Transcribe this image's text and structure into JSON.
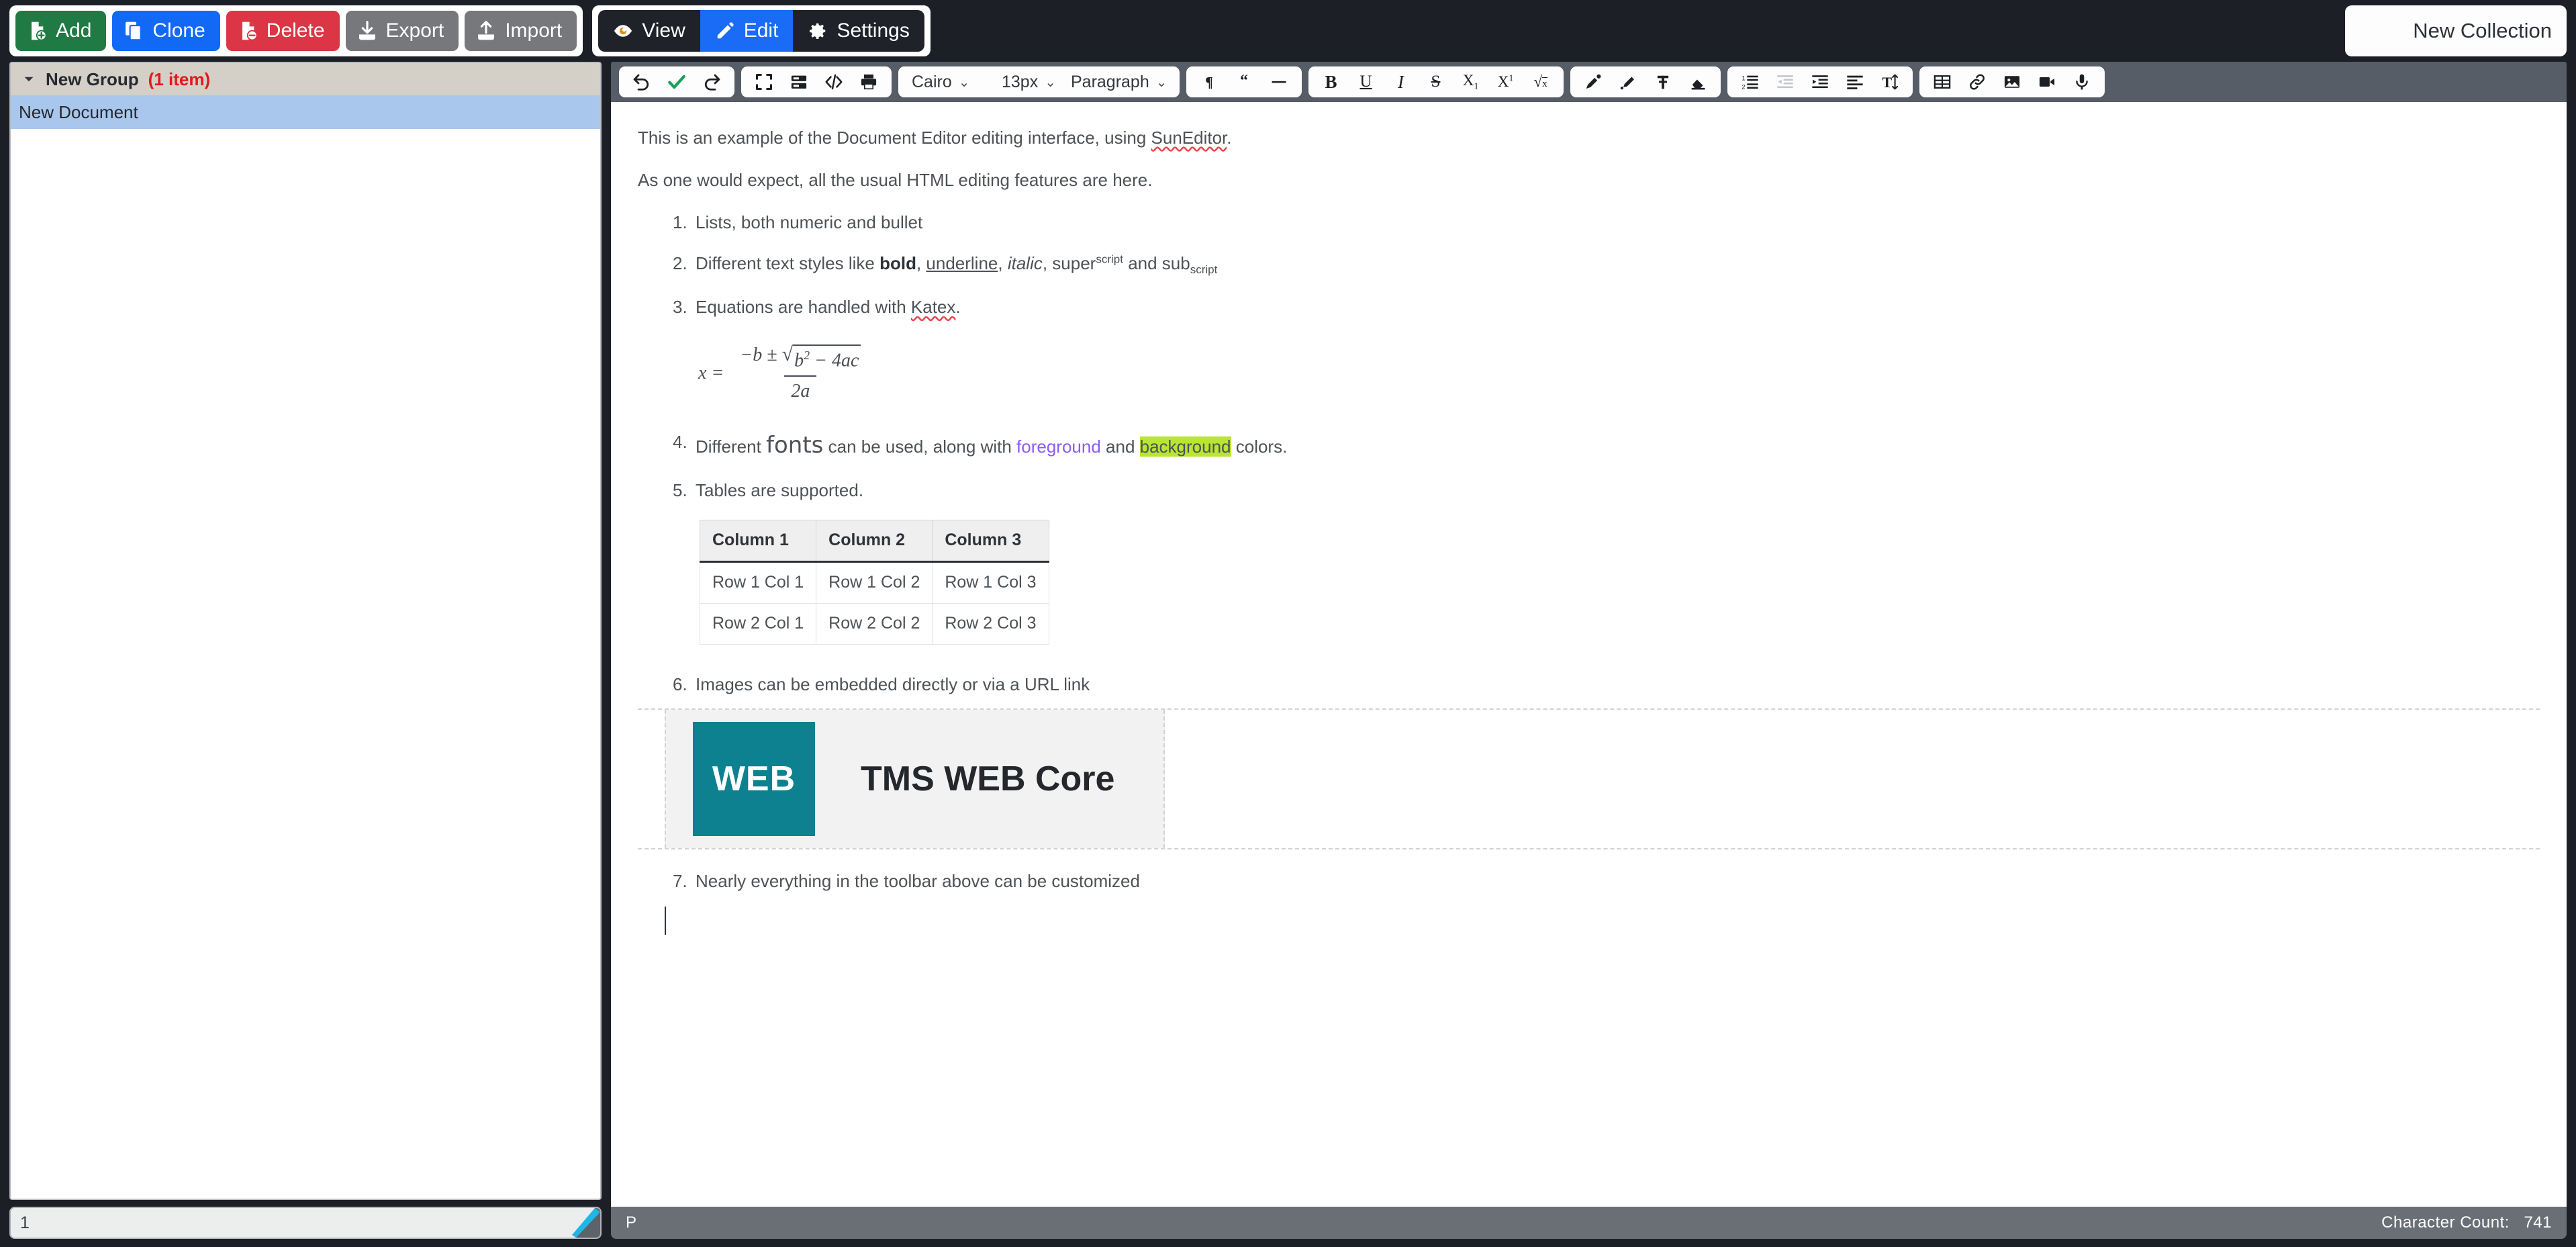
{
  "toolbar": {
    "buttons": [
      {
        "label": "Add",
        "icon": "file-add-icon",
        "color": "#1f7a43"
      },
      {
        "label": "Clone",
        "icon": "copy-icon",
        "color": "#1169f5"
      },
      {
        "label": "Delete",
        "icon": "file-remove-icon",
        "color": "#dc3545"
      },
      {
        "label": "Export",
        "icon": "download-icon",
        "color": "#76787c"
      },
      {
        "label": "Import",
        "icon": "upload-icon",
        "color": "#76787c"
      }
    ],
    "modes": [
      {
        "label": "View",
        "icon": "eye-icon",
        "active": false
      },
      {
        "label": "Edit",
        "icon": "pencil-icon",
        "active": true
      },
      {
        "label": "Settings",
        "icon": "gear-icon",
        "active": false
      }
    ],
    "collection_title": "New Collection",
    "accent_active": "#1a6bf5"
  },
  "sidebar": {
    "group": {
      "label": "New Group",
      "count": "(1 item)",
      "expanded": true
    },
    "documents": [
      {
        "label": "New Document",
        "selected": true
      }
    ],
    "status": "1"
  },
  "editor_toolbar": {
    "history": [
      {
        "name": "undo-icon",
        "label": "Undo"
      },
      {
        "name": "check-icon",
        "label": "Save"
      },
      {
        "name": "redo-icon",
        "label": "Redo"
      }
    ],
    "view_tools": [
      {
        "name": "fullscreen-icon",
        "label": "Full Screen"
      },
      {
        "name": "preview-icon",
        "label": "Preview"
      },
      {
        "name": "code-view-icon",
        "label": "Code View"
      },
      {
        "name": "print-icon",
        "label": "Print"
      }
    ],
    "font_family": "Cairo",
    "font_size": "13px",
    "paragraph_style": "Paragraph",
    "block_tools": [
      {
        "name": "paragraph-icon",
        "label": "Paragraph Mark"
      },
      {
        "name": "blockquote-icon",
        "label": "Blockquote"
      },
      {
        "name": "horizontal-rule-icon",
        "label": "Horizontal Line"
      }
    ],
    "text_tools": [
      {
        "name": "bold-icon",
        "label": "B"
      },
      {
        "name": "underline-icon",
        "label": "U"
      },
      {
        "name": "italic-icon",
        "label": "I"
      },
      {
        "name": "strikethrough-icon",
        "label": "S"
      },
      {
        "name": "subscript-icon",
        "label": "X"
      },
      {
        "name": "superscript-icon",
        "label": "X"
      },
      {
        "name": "math-icon",
        "label": "Math"
      }
    ],
    "color_tools": [
      {
        "name": "font-color-icon",
        "label": "Font Color"
      },
      {
        "name": "highlight-color-icon",
        "label": "Highlight Color"
      },
      {
        "name": "text-style-icon",
        "label": "Text Style"
      },
      {
        "name": "remove-format-icon",
        "label": "Remove Format"
      }
    ],
    "list_tools": [
      {
        "name": "ordered-list-icon",
        "label": "List",
        "disabled": false
      },
      {
        "name": "outdent-icon",
        "label": "Outdent",
        "disabled": true
      },
      {
        "name": "indent-icon",
        "label": "Indent",
        "disabled": false
      },
      {
        "name": "align-icon",
        "label": "Align",
        "disabled": false
      },
      {
        "name": "line-height-icon",
        "label": "Line Height",
        "disabled": false
      }
    ],
    "insert_tools": [
      {
        "name": "table-icon",
        "label": "Table"
      },
      {
        "name": "link-icon",
        "label": "Link"
      },
      {
        "name": "image-icon",
        "label": "Image"
      },
      {
        "name": "video-icon",
        "label": "Video"
      },
      {
        "name": "audio-icon",
        "label": "Audio"
      }
    ]
  },
  "document": {
    "intro_1_a": "This is an example of the Document Editor editing interface, using ",
    "intro_1_link": "SunEditor",
    "intro_1_b": ".",
    "intro_2": "As one would expect, all the usual HTML editing features are here.",
    "items": [
      {
        "num": "1.",
        "text": "Lists, both numeric and bullet"
      },
      {
        "num": "2.",
        "text": "Different text styles like bold, underline, italic, superscript and subscript"
      },
      {
        "num": "3.",
        "text": "Equations are handled with Katex."
      },
      {
        "num": "4.",
        "text": "Different fonts can be used, along with foreground and background colors."
      },
      {
        "num": "5.",
        "text": "Tables are supported."
      },
      {
        "num": "6.",
        "text": "Images can be embedded directly or via a URL link"
      },
      {
        "num": "7.",
        "text": "Nearly everything in the toolbar above can be customized"
      }
    ],
    "item2": {
      "prefix": "Different text styles like ",
      "bold": "bold",
      "sep1": ", ",
      "underline": "underline",
      "sep2": ", ",
      "italic": "italic",
      "sep3": ", super",
      "sup": "script",
      "sep4": " and sub",
      "sub": "script"
    },
    "item3": {
      "prefix": "Equations are handled with ",
      "link": "Katex",
      "suffix": "."
    },
    "item4": {
      "prefix": "Different ",
      "fonts": "fonts",
      "mid": " can be used, along with ",
      "foreground": "foreground",
      "and": " and ",
      "background": "background",
      "suffix": " colors.",
      "foreground_color": "#8b5cf6",
      "background_color": "#b9e533"
    },
    "equation": {
      "lhs": "x =",
      "numerator_a": "−b ±",
      "radical": "√",
      "radicand": "b",
      "radicand_exp": "2",
      "radicand_rest": " − 4ac",
      "denominator": "2a"
    },
    "table": {
      "headers": [
        "Column 1",
        "Column 2",
        "Column 3"
      ],
      "rows": [
        [
          "Row 1 Col 1",
          "Row 1 Col 2",
          "Row 1 Col 3"
        ],
        [
          "Row 2 Col 1",
          "Row 2 Col 2",
          "Row 2 Col 3"
        ]
      ]
    },
    "image": {
      "logo_text": "WEB",
      "title": "TMS WEB Core",
      "logo_color": "#0d8190"
    }
  },
  "editor_status": {
    "left": "P",
    "character_count_label": "Character Count:",
    "character_count_value": "741"
  }
}
